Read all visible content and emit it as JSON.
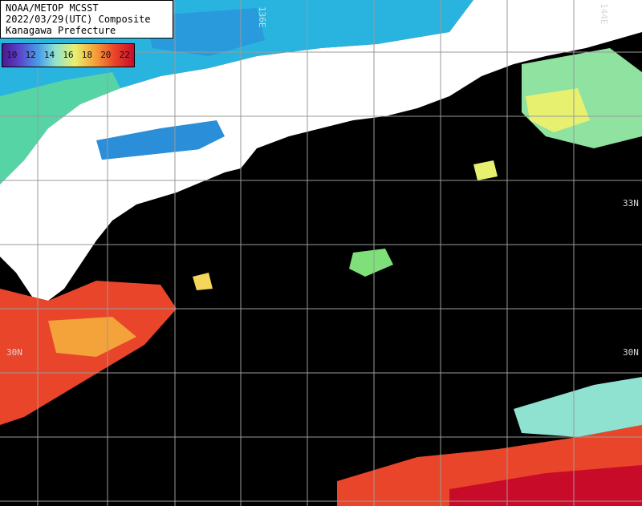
{
  "title": {
    "line1": "NOAA/METOP MCSST",
    "line2": "2022/03/29(UTC) Composite",
    "line3": "Kanagawa Prefecture"
  },
  "legend": {
    "labels": [
      "10",
      "12",
      "14",
      "16",
      "18",
      "20",
      "22"
    ]
  },
  "grid_labels": {
    "lon_136": "136E",
    "lon_144": "144E",
    "lat_33": "33N",
    "lat_30_left": "30N",
    "lat_30_right": "30N"
  },
  "colors": {
    "land": "#ffffff",
    "no_data": "#000000",
    "grid": "#9a9a9a",
    "cold_cyan": "#2fb8e8",
    "warm_red": "#e9452a"
  }
}
